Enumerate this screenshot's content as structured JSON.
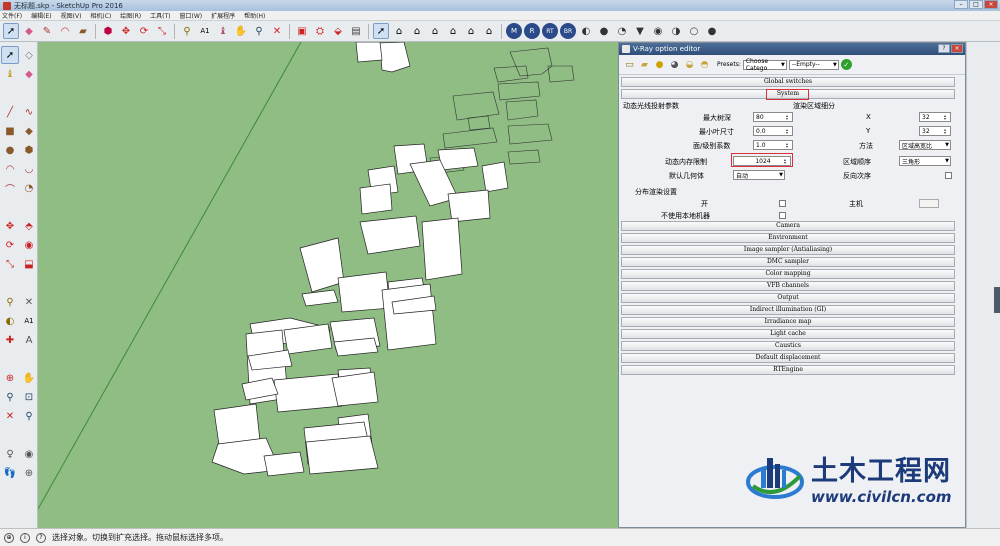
{
  "window": {
    "title": "无标题.skp - SketchUp Pro 2016"
  },
  "menu": [
    "文件(F)",
    "编辑(E)",
    "视图(V)",
    "相机(C)",
    "绘图(R)",
    "工具(T)",
    "窗口(W)",
    "扩展程序",
    "帮助(H)"
  ],
  "toolbar": {
    "icons": [
      "select-icon",
      "eraser-icon",
      "pencil-icon",
      "arc-icon",
      "rectangle-icon",
      "push-pull-icon",
      "move-icon",
      "rotate-icon",
      "scale-icon",
      "offset-icon",
      "tape-icon",
      "text-icon",
      "paint-icon",
      "orbit-icon",
      "pan-icon",
      "zoom-icon",
      "zoom-extents-icon",
      "component-icon",
      "warehouse-icon",
      "extension-icon",
      "section-icon",
      "select-icon",
      "house-icon",
      "front-view-icon",
      "right-view-icon",
      "back-view-icon",
      "left-view-icon",
      "top-view-icon",
      "iso-view-icon",
      "vray-m-icon",
      "vray-render-icon",
      "vray-rt-icon",
      "vray-batch-icon",
      "vray-light-icon",
      "vray-sphere-icon",
      "vray-dome-icon",
      "vray-ies-icon",
      "vray-mesh-icon",
      "vray-plane-icon",
      "vray-proxy-icon",
      "vray-infinite-icon"
    ]
  },
  "vray": {
    "window_title": "V-Ray option editor",
    "presets_label": "Presets:",
    "preset_category": "Choose Catego",
    "preset_value": "--Empty--",
    "rollouts_top": [
      "Global switches",
      "System"
    ],
    "system": {
      "dynamic_header": "动态光线投射参数",
      "region_header": "渲染区域细分",
      "max_depth_label": "最大树深",
      "max_depth_value": "80",
      "min_leaf_label": "最小叶尺寸",
      "min_leaf_value": "0.0",
      "face_coef_label": "面/级别系数",
      "face_coef_value": "1.0",
      "mem_limit_label": "动态内存限制",
      "mem_limit_value": "1024",
      "default_geom_label": "默认几何体",
      "default_geom_value": "自动",
      "x_label": "X",
      "x_value": "32",
      "y_label": "Y",
      "y_value": "32",
      "method_label": "方法",
      "method_value": "区域高宽比",
      "order_label": "区域顺序",
      "order_value": "三角形",
      "reverse_label": "反向次序",
      "distributed_header": "分布渲染设置",
      "on_label": "开",
      "host_label": "主机",
      "local_label": "不使用本地机器"
    },
    "rollouts_bottom": [
      "Camera",
      "Environment",
      "Image sampler (Antialiasing)",
      "DMC sampler",
      "Color mapping",
      "VFB channels",
      "Output",
      "Indirect illumination (GI)",
      "Irradiance map",
      "Light cache",
      "Caustics",
      "Default displacement",
      "RTEngine"
    ]
  },
  "status": {
    "text": "选择对象。切换到扩充选择。拖动鼠标选择多项。"
  },
  "watermark": {
    "cn": "土木工程网",
    "url": "www.civilcn.com"
  },
  "colors": {
    "viewport_bg": "#8fbd84",
    "highlight": "#d9303a"
  }
}
